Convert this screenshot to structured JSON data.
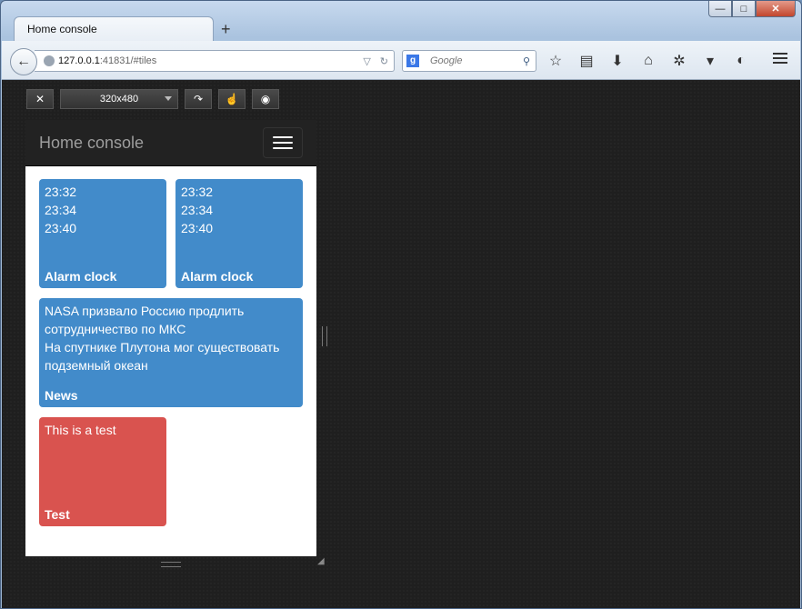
{
  "browser": {
    "tab_title": "Home console",
    "new_tab": "+",
    "url_host": "127.0.0.1",
    "url_rest": ":41831/#tiles",
    "search_engine": "g",
    "search_placeholder": "Google",
    "window_buttons": {
      "minimize": "—",
      "maximize": "□",
      "close": "✕"
    }
  },
  "responsive_toolbar": {
    "close_label": "✕",
    "size_value": "320x480",
    "rotate_label": "↷",
    "touch_label": "☝",
    "screenshot_label": "◉"
  },
  "app": {
    "brand": "Home console",
    "tiles": [
      {
        "lines": [
          "23:32",
          "23:34",
          "23:40"
        ],
        "name": "Alarm clock",
        "color": "#428bca"
      },
      {
        "lines": [
          "23:32",
          "23:34",
          "23:40"
        ],
        "name": "Alarm clock",
        "color": "#428bca"
      },
      {
        "lines": [
          "NASA призвало Россию продлить сотрудничество по МКС",
          "На спутнике Плутона мог существовать подземный океан"
        ],
        "name": "News",
        "color": "#428bca"
      },
      {
        "lines": [
          "This is a test"
        ],
        "name": "Test",
        "color": "#d9534f"
      }
    ]
  }
}
